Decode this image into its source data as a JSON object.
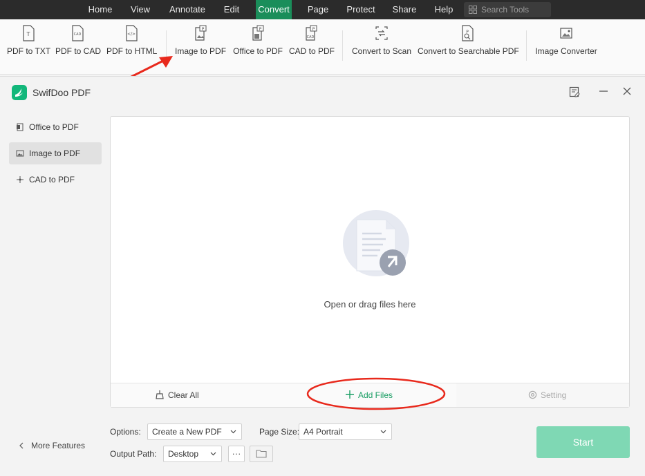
{
  "menubar": {
    "items": [
      "Home",
      "View",
      "Annotate",
      "Edit",
      "Convert",
      "Page",
      "Protect",
      "Share",
      "Help"
    ],
    "active": "Convert",
    "search_placeholder": "Search Tools"
  },
  "ribbon": {
    "items": [
      {
        "label": "PDF to TXT",
        "icon": "pdf-to-txt-icon"
      },
      {
        "label": "PDF to CAD",
        "icon": "pdf-to-cad-icon"
      },
      {
        "label": "PDF to HTML",
        "icon": "pdf-to-html-icon"
      },
      {
        "label": "Image to PDF",
        "icon": "image-to-pdf-icon"
      },
      {
        "label": "Office to PDF",
        "icon": "office-to-pdf-icon"
      },
      {
        "label": "CAD to PDF",
        "icon": "cad-to-pdf-icon"
      },
      {
        "label": "Convert to Scan",
        "icon": "convert-to-scan-icon"
      },
      {
        "label": "Convert to Searchable PDF",
        "icon": "searchable-pdf-icon"
      },
      {
        "label": "Image Converter",
        "icon": "image-converter-icon"
      }
    ]
  },
  "dialog": {
    "title": "SwifDoo PDF",
    "sidebar": [
      {
        "label": "Office to PDF",
        "active": false
      },
      {
        "label": "Image to PDF",
        "active": true
      },
      {
        "label": "CAD to PDF",
        "active": false
      }
    ],
    "more_features": "More Features",
    "dropzone_text": "Open or drag files here",
    "footer": {
      "clear_all": "Clear All",
      "add_files": "Add Files",
      "setting": "Setting"
    },
    "options_label": "Options:",
    "options_value": "Create a New PDF",
    "page_size_label": "Page Size:",
    "page_size_value": "A4 Portrait",
    "output_path_label": "Output Path:",
    "output_path_value": "Desktop",
    "more_button": "···",
    "start": "Start"
  },
  "colors": {
    "accent": "#1a8e5a",
    "start_button": "#7fd8b4",
    "add_files_text": "#1a9e64",
    "annotation_red": "#e8291c"
  }
}
